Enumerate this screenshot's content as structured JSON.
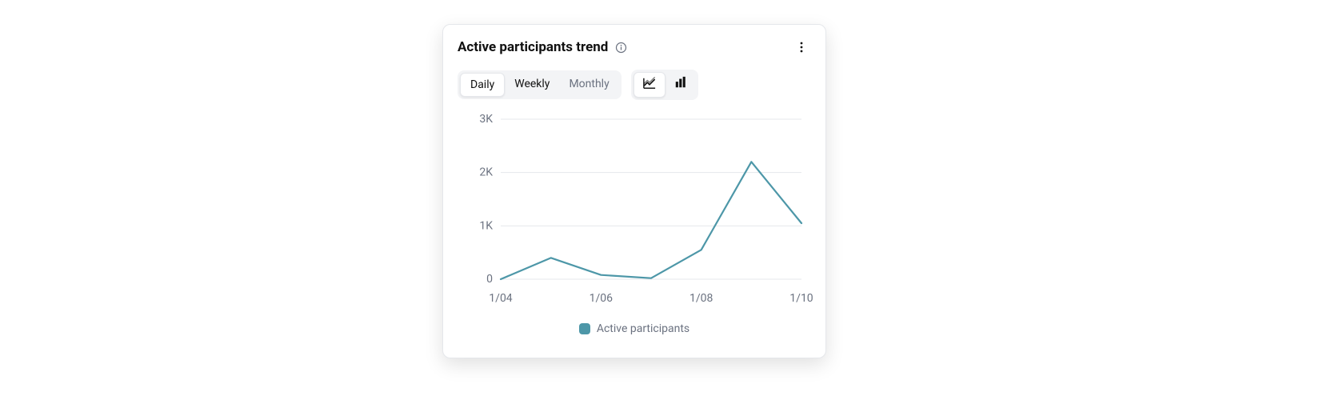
{
  "card": {
    "title": "Active participants trend",
    "info_tooltip": "info-icon",
    "more_menu": "more-vertical-icon"
  },
  "period_tabs": {
    "options": [
      {
        "id": "daily",
        "label": "Daily",
        "active": true,
        "enabled": true
      },
      {
        "id": "weekly",
        "label": "Weekly",
        "active": false,
        "enabled": true
      },
      {
        "id": "monthly",
        "label": "Monthly",
        "active": false,
        "enabled": false
      }
    ]
  },
  "chart_type_tabs": {
    "options": [
      {
        "id": "line",
        "icon": "line-chart-icon",
        "active": true
      },
      {
        "id": "bar",
        "icon": "bar-chart-icon",
        "active": false
      }
    ]
  },
  "legend": {
    "series_0": "Active participants",
    "color": "#4d97a8"
  },
  "y_ticks": {
    "t0": "0",
    "t1": "1K",
    "t2": "2K",
    "t3": "3K"
  },
  "x_ticks": {
    "t0": "1/04",
    "t1": "1/06",
    "t2": "1/08",
    "t3": "1/10"
  },
  "chart_data": {
    "type": "line",
    "title": "Active participants trend",
    "xlabel": "",
    "ylabel": "",
    "ylim": [
      0,
      3000
    ],
    "x": [
      "1/04",
      "1/05",
      "1/06",
      "1/07",
      "1/08",
      "1/09",
      "1/10"
    ],
    "series": [
      {
        "name": "Active participants",
        "color": "#4d97a8",
        "values": [
          0,
          400,
          80,
          20,
          550,
          2200,
          1050
        ]
      }
    ],
    "y_tick_labels": [
      "0",
      "1K",
      "2K",
      "3K"
    ],
    "x_tick_labels_shown": [
      "1/04",
      "1/06",
      "1/08",
      "1/10"
    ],
    "grid": {
      "horizontal": true,
      "vertical": false
    },
    "legend_position": "bottom"
  }
}
